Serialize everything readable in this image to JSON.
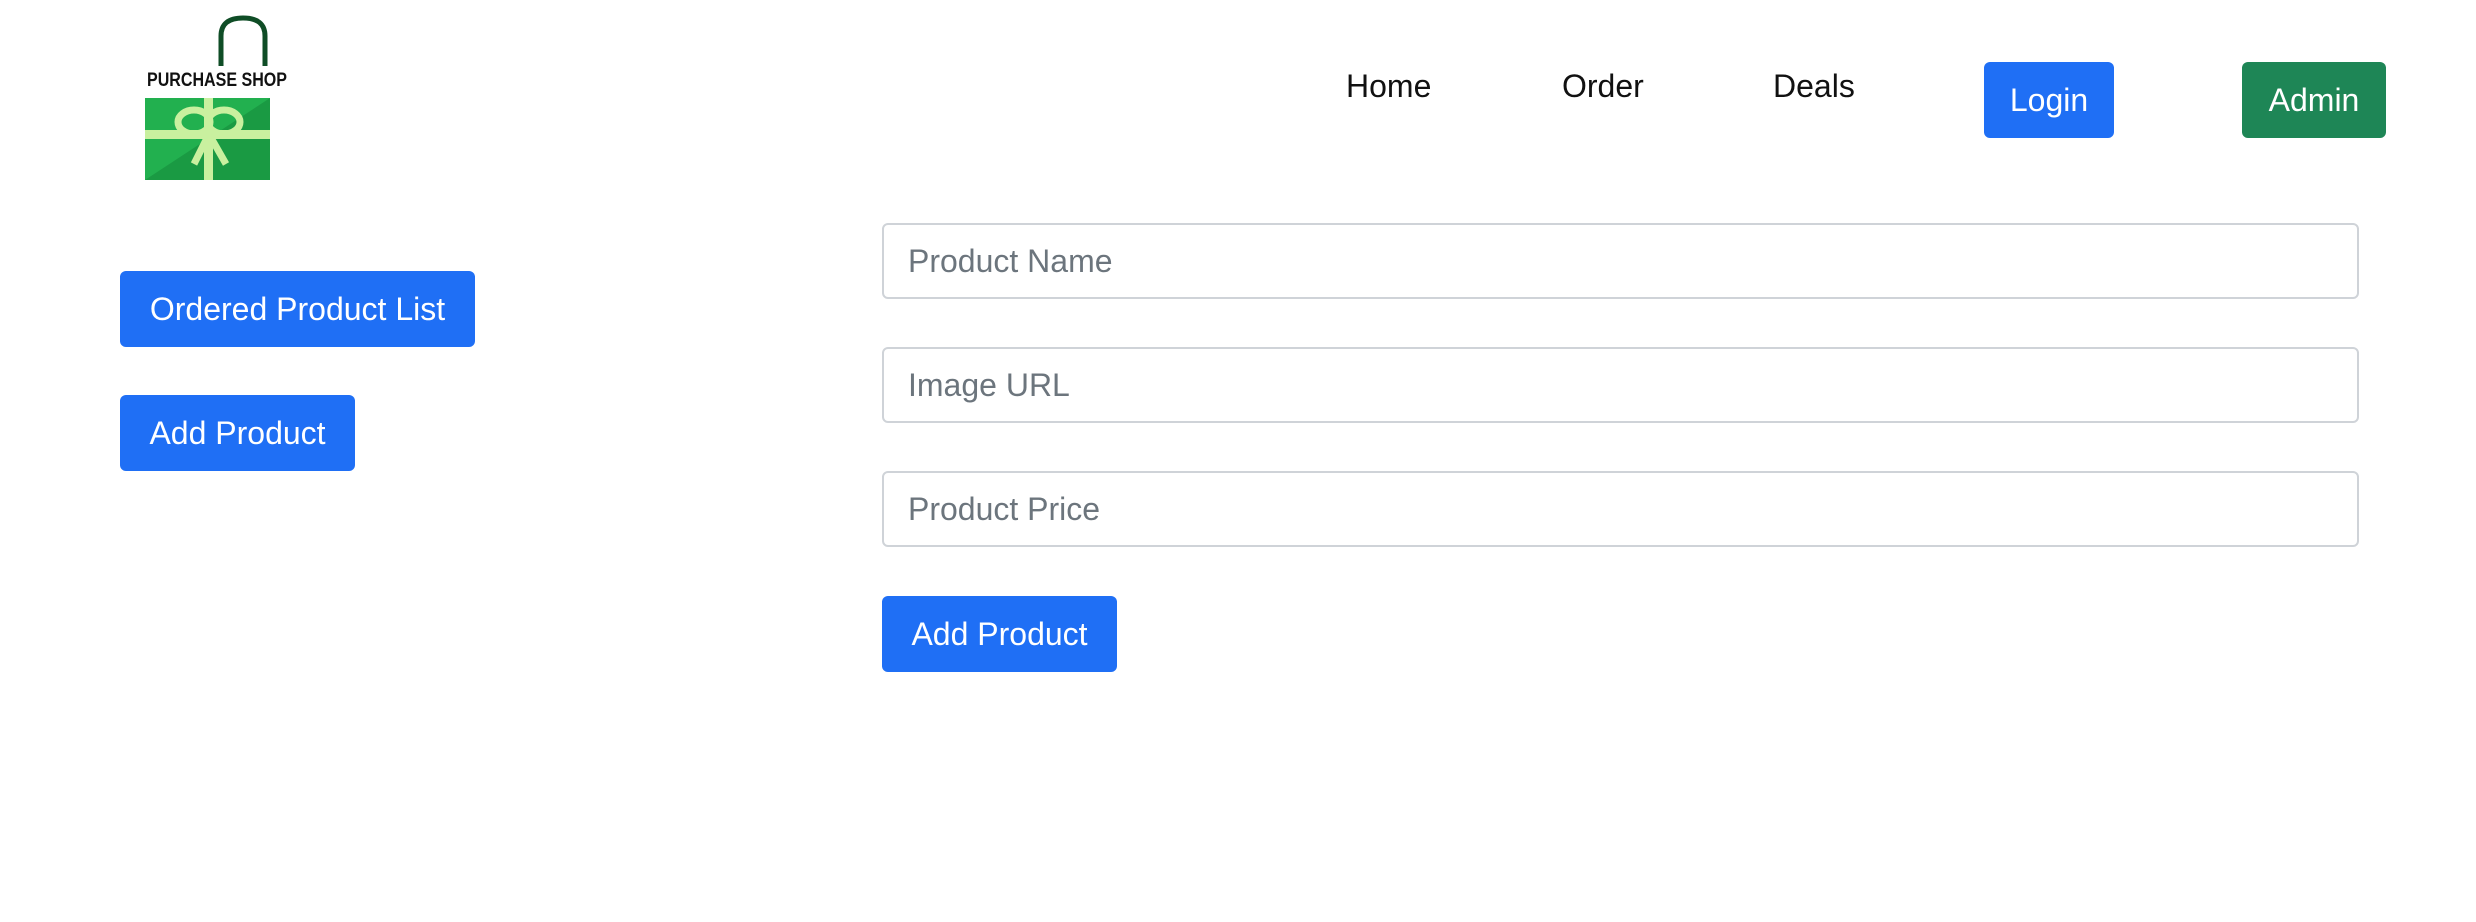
{
  "brand": {
    "logo_text": "PURCHASE SHOP"
  },
  "nav": {
    "home": "Home",
    "order": "Order",
    "deals": "Deals",
    "login": "Login",
    "admin": "Admin"
  },
  "sidebar": {
    "ordered_list_label": "Ordered Product List",
    "add_product_label": "Add Product"
  },
  "form": {
    "product_name": {
      "value": "",
      "placeholder": "Product Name"
    },
    "image_url": {
      "value": "",
      "placeholder": "Image URL"
    },
    "product_price": {
      "value": "",
      "placeholder": "Product Price"
    },
    "submit_label": "Add Product"
  },
  "colors": {
    "primary": "#1f6ff5",
    "success": "#1e8656",
    "logo_dark_green": "#0f4d26",
    "logo_green": "#22b04f",
    "logo_light_green": "#c9f09f"
  }
}
